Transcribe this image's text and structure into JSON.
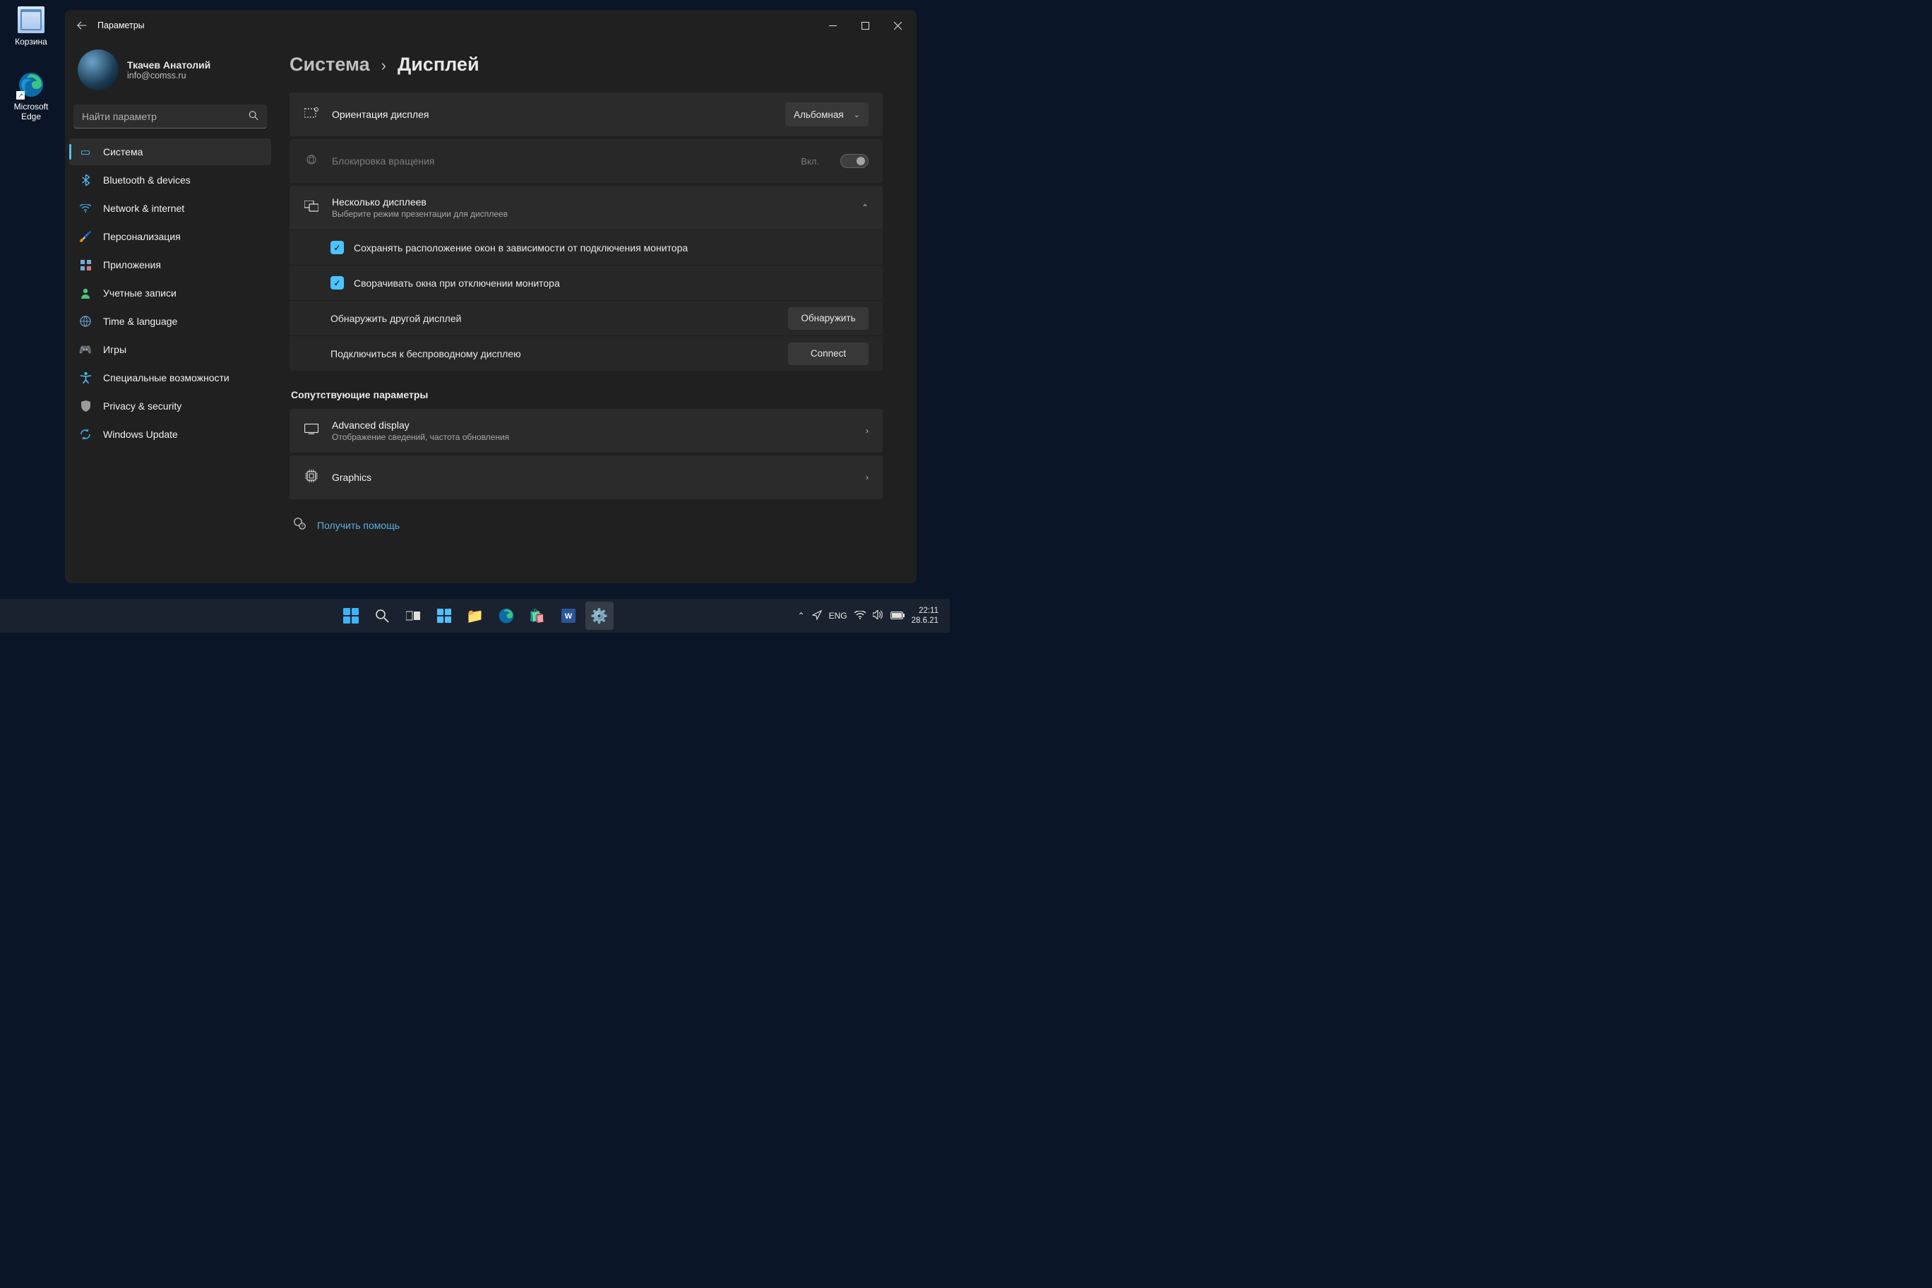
{
  "desktop": {
    "recycle_bin": "Корзина",
    "edge": "Microsoft Edge"
  },
  "window": {
    "title": "Параметры",
    "profile": {
      "name": "Ткачев Анатолий",
      "email": "info@comss.ru"
    },
    "search_placeholder": "Найти параметр",
    "nav": {
      "system": "Система",
      "bluetooth": "Bluetooth & devices",
      "network": "Network & internet",
      "personalization": "Персонализация",
      "apps": "Приложения",
      "accounts": "Учетные записи",
      "time_lang": "Time & language",
      "games": "Игры",
      "accessibility": "Специальные возможности",
      "privacy": "Privacy & security",
      "update": "Windows Update"
    },
    "breadcrumb": {
      "parent": "Система",
      "current": "Дисплей"
    },
    "rows": {
      "orientation": {
        "title": "Ориентация дисплея",
        "value": "Альбомная"
      },
      "rotation_lock": {
        "title": "Блокировка вращения",
        "state": "Вкл."
      },
      "multi_display": {
        "title": "Несколько дисплеев",
        "sub": "Выберите режим презентации для дисплеев"
      },
      "remember_windows": "Сохранять расположение окон в зависимости от подключения монитора",
      "minimize_on_disconnect": "Сворачивать окна при отключении монитора",
      "detect": {
        "title": "Обнаружить другой дисплей",
        "button": "Обнаружить"
      },
      "wireless": {
        "title": "Подключиться к беспроводному дисплею",
        "button": "Connect"
      },
      "related_header": "Сопутствующие параметры",
      "advanced": {
        "title": "Advanced display",
        "sub": "Отображение сведений, частота обновления"
      },
      "graphics": {
        "title": "Graphics"
      },
      "help": "Получить помощь"
    }
  },
  "taskbar": {
    "lang": "ENG",
    "time": "22:11",
    "date": "28.6.21"
  }
}
